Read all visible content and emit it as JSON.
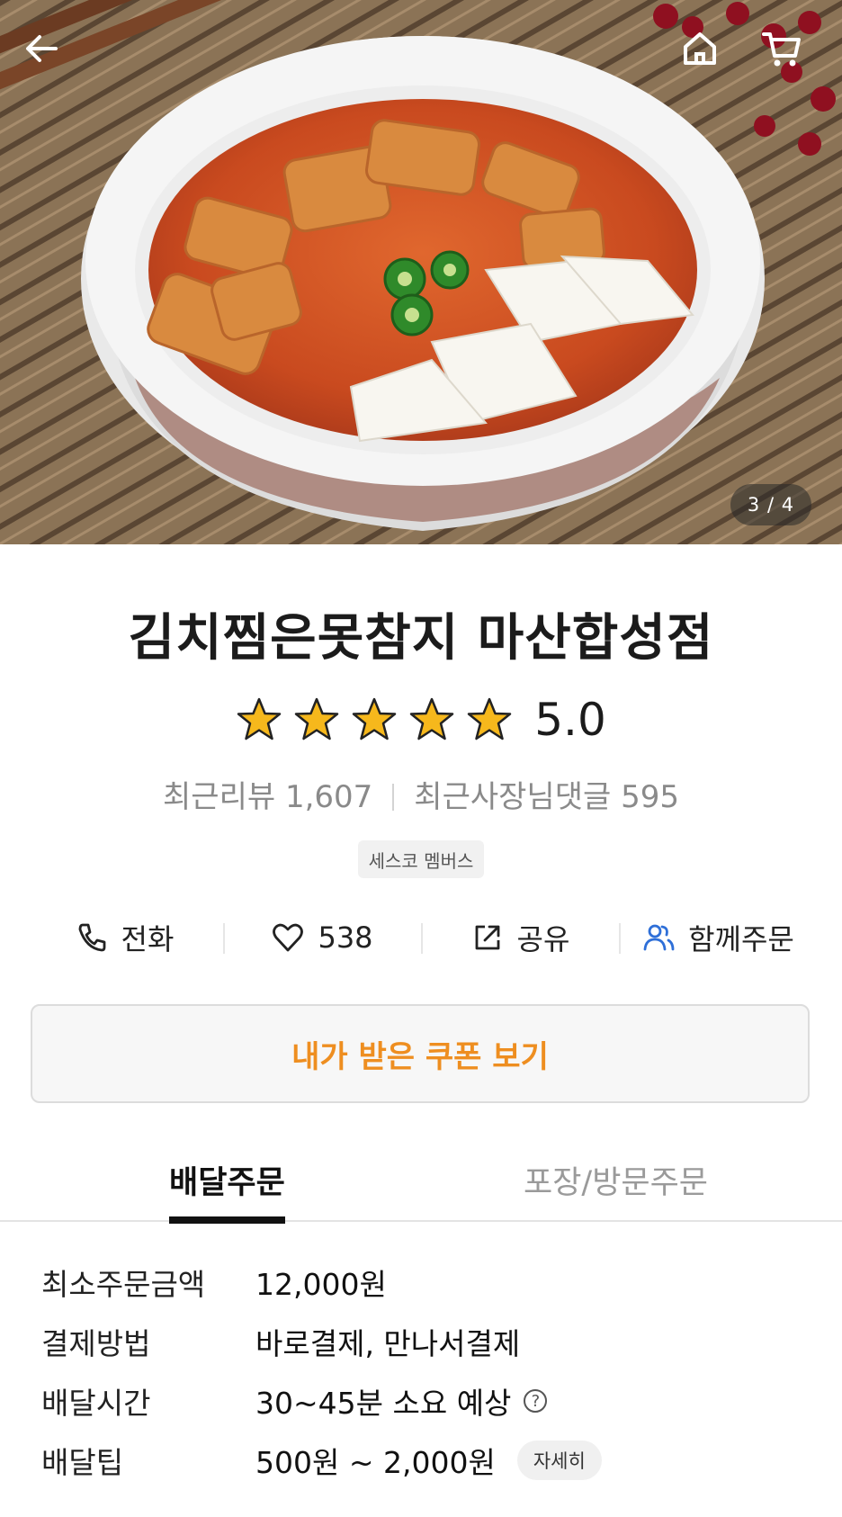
{
  "hero": {
    "page_counter": "3 / 4"
  },
  "store": {
    "name": "김치찜은못참지 마산합성점",
    "rating": 5.0,
    "rating_text": "5.0",
    "review_text": "최근리뷰 1,607",
    "reply_text": "최근사장님댓글 595",
    "badge": "세스코 멤버스"
  },
  "actions": {
    "call": "전화",
    "likes": "538",
    "share": "공유",
    "group_order": "함께주문"
  },
  "coupon": {
    "label": "내가 받은 쿠폰 보기"
  },
  "tabs": {
    "delivery": "배달주문",
    "pickup": "포장/방문주문"
  },
  "info": {
    "min_order_label": "최소주문금액",
    "min_order_value": "12,000원",
    "payment_label": "결제방법",
    "payment_value": "바로결제, 만나서결제",
    "time_label": "배달시간",
    "time_value": "30~45분 소요 예상",
    "tip_label": "배달팁",
    "tip_value": "500원 ~ 2,000원",
    "tip_detail": "자세히"
  },
  "colors": {
    "accent_orange": "#ee8e20",
    "star_gold": "#f6b81c",
    "group_icon_blue": "#2e6fd8"
  },
  "icons": [
    "back-arrow-icon",
    "home-icon",
    "cart-icon",
    "star-icon",
    "phone-icon",
    "heart-icon",
    "share-icon",
    "group-order-icon",
    "help-icon"
  ]
}
